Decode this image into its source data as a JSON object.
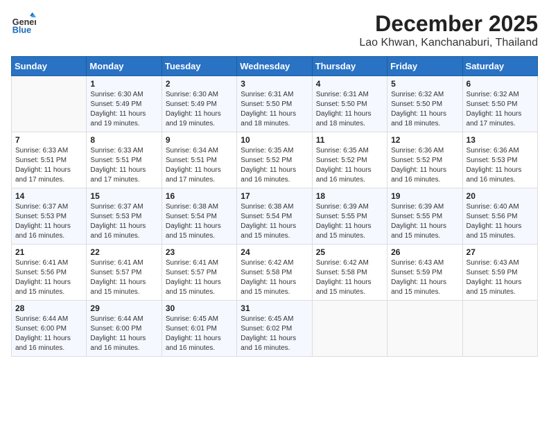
{
  "header": {
    "logo_general": "General",
    "logo_blue": "Blue",
    "month_title": "December 2025",
    "location": "Lao Khwan, Kanchanaburi, Thailand"
  },
  "weekdays": [
    "Sunday",
    "Monday",
    "Tuesday",
    "Wednesday",
    "Thursday",
    "Friday",
    "Saturday"
  ],
  "weeks": [
    [
      {
        "day": "",
        "sunrise": "",
        "sunset": "",
        "daylight": ""
      },
      {
        "day": "1",
        "sunrise": "Sunrise: 6:30 AM",
        "sunset": "Sunset: 5:49 PM",
        "daylight": "Daylight: 11 hours and 19 minutes."
      },
      {
        "day": "2",
        "sunrise": "Sunrise: 6:30 AM",
        "sunset": "Sunset: 5:49 PM",
        "daylight": "Daylight: 11 hours and 19 minutes."
      },
      {
        "day": "3",
        "sunrise": "Sunrise: 6:31 AM",
        "sunset": "Sunset: 5:50 PM",
        "daylight": "Daylight: 11 hours and 18 minutes."
      },
      {
        "day": "4",
        "sunrise": "Sunrise: 6:31 AM",
        "sunset": "Sunset: 5:50 PM",
        "daylight": "Daylight: 11 hours and 18 minutes."
      },
      {
        "day": "5",
        "sunrise": "Sunrise: 6:32 AM",
        "sunset": "Sunset: 5:50 PM",
        "daylight": "Daylight: 11 hours and 18 minutes."
      },
      {
        "day": "6",
        "sunrise": "Sunrise: 6:32 AM",
        "sunset": "Sunset: 5:50 PM",
        "daylight": "Daylight: 11 hours and 17 minutes."
      }
    ],
    [
      {
        "day": "7",
        "sunrise": "Sunrise: 6:33 AM",
        "sunset": "Sunset: 5:51 PM",
        "daylight": "Daylight: 11 hours and 17 minutes."
      },
      {
        "day": "8",
        "sunrise": "Sunrise: 6:33 AM",
        "sunset": "Sunset: 5:51 PM",
        "daylight": "Daylight: 11 hours and 17 minutes."
      },
      {
        "day": "9",
        "sunrise": "Sunrise: 6:34 AM",
        "sunset": "Sunset: 5:51 PM",
        "daylight": "Daylight: 11 hours and 17 minutes."
      },
      {
        "day": "10",
        "sunrise": "Sunrise: 6:35 AM",
        "sunset": "Sunset: 5:52 PM",
        "daylight": "Daylight: 11 hours and 16 minutes."
      },
      {
        "day": "11",
        "sunrise": "Sunrise: 6:35 AM",
        "sunset": "Sunset: 5:52 PM",
        "daylight": "Daylight: 11 hours and 16 minutes."
      },
      {
        "day": "12",
        "sunrise": "Sunrise: 6:36 AM",
        "sunset": "Sunset: 5:52 PM",
        "daylight": "Daylight: 11 hours and 16 minutes."
      },
      {
        "day": "13",
        "sunrise": "Sunrise: 6:36 AM",
        "sunset": "Sunset: 5:53 PM",
        "daylight": "Daylight: 11 hours and 16 minutes."
      }
    ],
    [
      {
        "day": "14",
        "sunrise": "Sunrise: 6:37 AM",
        "sunset": "Sunset: 5:53 PM",
        "daylight": "Daylight: 11 hours and 16 minutes."
      },
      {
        "day": "15",
        "sunrise": "Sunrise: 6:37 AM",
        "sunset": "Sunset: 5:53 PM",
        "daylight": "Daylight: 11 hours and 16 minutes."
      },
      {
        "day": "16",
        "sunrise": "Sunrise: 6:38 AM",
        "sunset": "Sunset: 5:54 PM",
        "daylight": "Daylight: 11 hours and 15 minutes."
      },
      {
        "day": "17",
        "sunrise": "Sunrise: 6:38 AM",
        "sunset": "Sunset: 5:54 PM",
        "daylight": "Daylight: 11 hours and 15 minutes."
      },
      {
        "day": "18",
        "sunrise": "Sunrise: 6:39 AM",
        "sunset": "Sunset: 5:55 PM",
        "daylight": "Daylight: 11 hours and 15 minutes."
      },
      {
        "day": "19",
        "sunrise": "Sunrise: 6:39 AM",
        "sunset": "Sunset: 5:55 PM",
        "daylight": "Daylight: 11 hours and 15 minutes."
      },
      {
        "day": "20",
        "sunrise": "Sunrise: 6:40 AM",
        "sunset": "Sunset: 5:56 PM",
        "daylight": "Daylight: 11 hours and 15 minutes."
      }
    ],
    [
      {
        "day": "21",
        "sunrise": "Sunrise: 6:41 AM",
        "sunset": "Sunset: 5:56 PM",
        "daylight": "Daylight: 11 hours and 15 minutes."
      },
      {
        "day": "22",
        "sunrise": "Sunrise: 6:41 AM",
        "sunset": "Sunset: 5:57 PM",
        "daylight": "Daylight: 11 hours and 15 minutes."
      },
      {
        "day": "23",
        "sunrise": "Sunrise: 6:41 AM",
        "sunset": "Sunset: 5:57 PM",
        "daylight": "Daylight: 11 hours and 15 minutes."
      },
      {
        "day": "24",
        "sunrise": "Sunrise: 6:42 AM",
        "sunset": "Sunset: 5:58 PM",
        "daylight": "Daylight: 11 hours and 15 minutes."
      },
      {
        "day": "25",
        "sunrise": "Sunrise: 6:42 AM",
        "sunset": "Sunset: 5:58 PM",
        "daylight": "Daylight: 11 hours and 15 minutes."
      },
      {
        "day": "26",
        "sunrise": "Sunrise: 6:43 AM",
        "sunset": "Sunset: 5:59 PM",
        "daylight": "Daylight: 11 hours and 15 minutes."
      },
      {
        "day": "27",
        "sunrise": "Sunrise: 6:43 AM",
        "sunset": "Sunset: 5:59 PM",
        "daylight": "Daylight: 11 hours and 15 minutes."
      }
    ],
    [
      {
        "day": "28",
        "sunrise": "Sunrise: 6:44 AM",
        "sunset": "Sunset: 6:00 PM",
        "daylight": "Daylight: 11 hours and 16 minutes."
      },
      {
        "day": "29",
        "sunrise": "Sunrise: 6:44 AM",
        "sunset": "Sunset: 6:00 PM",
        "daylight": "Daylight: 11 hours and 16 minutes."
      },
      {
        "day": "30",
        "sunrise": "Sunrise: 6:45 AM",
        "sunset": "Sunset: 6:01 PM",
        "daylight": "Daylight: 11 hours and 16 minutes."
      },
      {
        "day": "31",
        "sunrise": "Sunrise: 6:45 AM",
        "sunset": "Sunset: 6:02 PM",
        "daylight": "Daylight: 11 hours and 16 minutes."
      },
      {
        "day": "",
        "sunrise": "",
        "sunset": "",
        "daylight": ""
      },
      {
        "day": "",
        "sunrise": "",
        "sunset": "",
        "daylight": ""
      },
      {
        "day": "",
        "sunrise": "",
        "sunset": "",
        "daylight": ""
      }
    ]
  ]
}
